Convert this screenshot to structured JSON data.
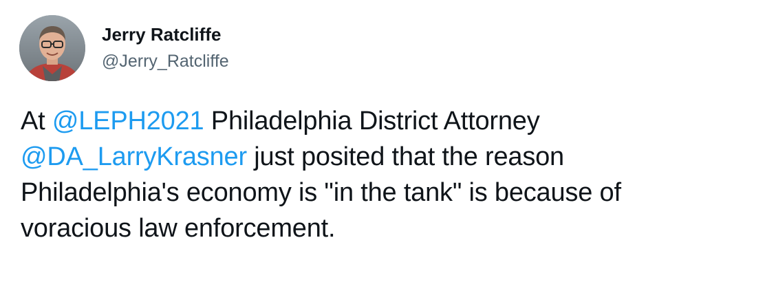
{
  "colors": {
    "text": "#0f1419",
    "secondary": "#536471",
    "link": "#1d9bf0",
    "background": "#ffffff"
  },
  "author": {
    "display_name": "Jerry Ratcliffe",
    "handle": "@Jerry_Ratcliffe",
    "avatar_icon": "profile-photo"
  },
  "tweet": {
    "lines": [
      {
        "t1": "At ",
        "m1": "@LEPH2021",
        "t2": " Philadelphia District Attorney"
      },
      {
        "m1": "@DA_LarryKrasner",
        "t2": " just posited that the reason"
      },
      {
        "t1": "Philadelphia's economy is \"in the tank\" is because of"
      },
      {
        "t1": "voracious law enforcement."
      }
    ]
  }
}
